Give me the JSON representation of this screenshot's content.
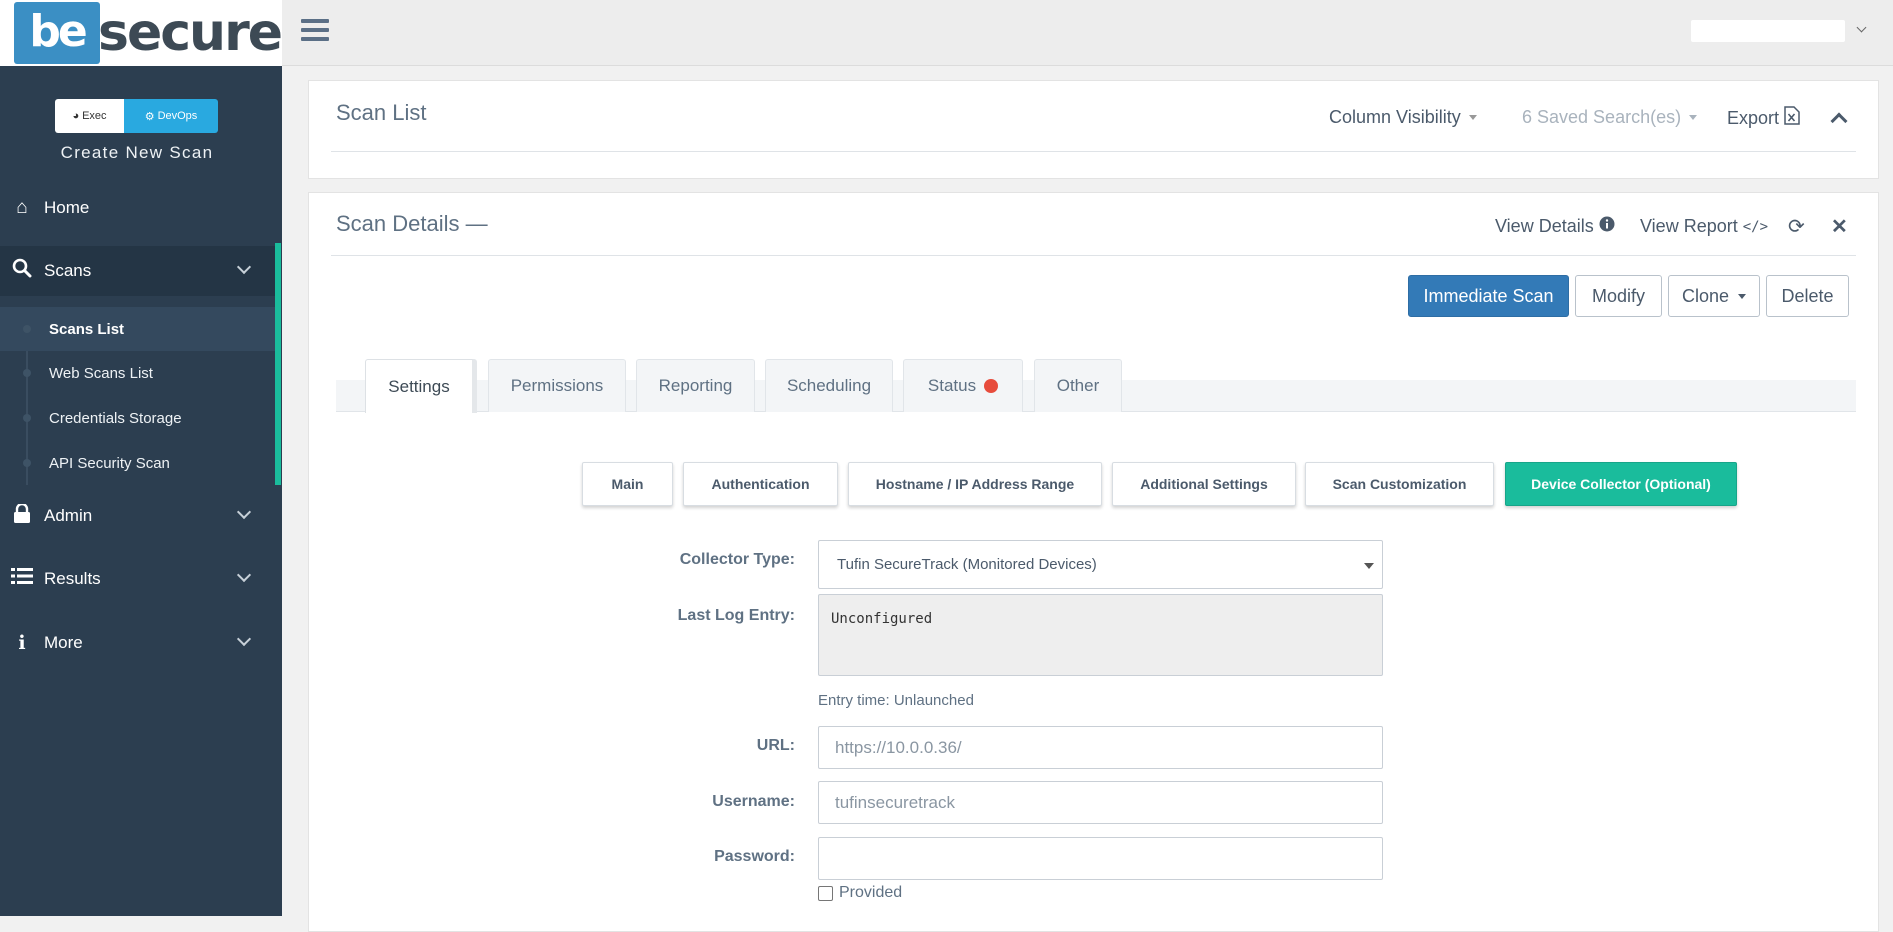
{
  "brand": {
    "mark": "be",
    "word": "secure"
  },
  "sidebar": {
    "mode_exec": "Exec",
    "mode_devops": "DevOps",
    "create_scan": "Create New Scan",
    "items": {
      "home": "Home",
      "scans": "Scans",
      "admin": "Admin",
      "results": "Results",
      "more": "More"
    },
    "scan_sub": [
      "Scans List",
      "Web Scans List",
      "Credentials Storage",
      "API Security Scan"
    ]
  },
  "scan_list": {
    "title": "Scan List",
    "column_visibility": "Column Visibility",
    "saved_searches": "6 Saved Search(es)",
    "export": "Export"
  },
  "scan_details": {
    "title": "Scan Details —",
    "view_details": "View Details",
    "view_report": "View Report",
    "buttons": {
      "immediate": "Immediate Scan",
      "modify": "Modify",
      "clone": "Clone",
      "delete": "Delete"
    },
    "tabs": [
      "Settings",
      "Permissions",
      "Reporting",
      "Scheduling",
      "Status",
      "Other"
    ],
    "subtabs": [
      "Main",
      "Authentication",
      "Hostname / IP Address Range",
      "Additional Settings",
      "Scan Customization",
      "Device Collector (Optional)"
    ]
  },
  "form": {
    "collector_type_label": "Collector Type:",
    "collector_type_value": "Tufin SecureTrack (Monitored Devices)",
    "last_log_label": "Last Log Entry:",
    "last_log_value": "Unconfigured",
    "entry_time": "Entry time: Unlaunched",
    "url_label": "URL:",
    "url_value": "https://10.0.0.36/",
    "username_label": "Username:",
    "username_value": "tufinsecuretrack",
    "password_label": "Password:",
    "provided_label": "Provided"
  },
  "colors": {
    "sidebar_bg": "#2c3e50",
    "accent_teal": "#1abc9c",
    "primary_blue": "#337ab7",
    "status_red": "#e74c3c",
    "devops_blue": "#29a9e0"
  },
  "icons": [
    "home-icon",
    "search-icon",
    "lock-icon",
    "list-icon",
    "info-icon",
    "excel-icon",
    "info-circle-icon",
    "code-icon",
    "refresh-icon",
    "close-icon"
  ]
}
